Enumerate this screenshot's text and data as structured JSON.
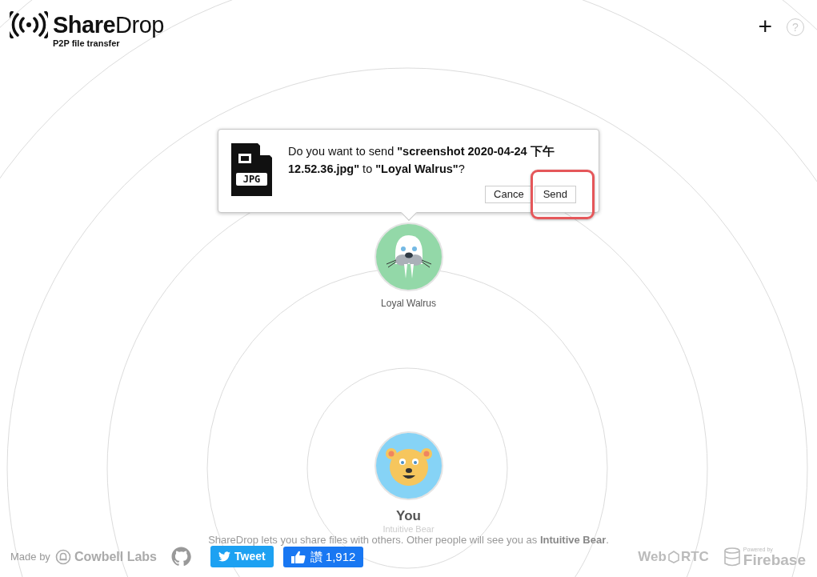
{
  "header": {
    "logo_bold": "Share",
    "logo_light": "Drop",
    "tagline": "P2P file transfer"
  },
  "header_buttons": [
    {
      "kind": "add",
      "label": "+"
    },
    {
      "kind": "help",
      "label": "?"
    }
  ],
  "popover": {
    "file_type": "JPG",
    "message": "Do you want to send **\"screenshot 2020-04-24 下午 12.52.36.jpg\"** to **\"Loyal Walrus\"**?",
    "buttons": [
      {
        "label": "Cance",
        "highlighted": false
      },
      {
        "label": "Send",
        "highlighted": true
      }
    ]
  },
  "peers": [
    {
      "name": "Loyal Walrus",
      "kind": "walrus"
    }
  ],
  "you": {
    "title": "You",
    "name": "Intuitive Bear",
    "kind": "bear"
  },
  "info": "ShareDrop lets you share files with others. Other people will see you as **Intuitive Bear**.",
  "footer": {
    "made_by": "Made by",
    "company": "Cowbell Labs",
    "tweet": "Tweet",
    "like_label": "讚",
    "like_count": "1,912",
    "webrtc_left": "Web",
    "webrtc_right": "RTC",
    "firebase_small": "Powered by",
    "firebase": "Firebase"
  }
}
